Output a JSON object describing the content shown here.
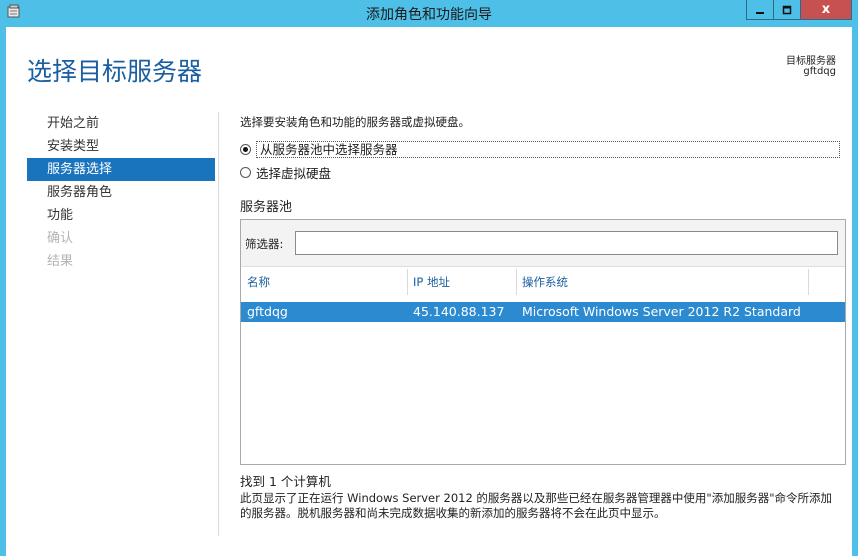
{
  "window": {
    "title": "添加角色和功能向导",
    "controls": {
      "minimize": "_",
      "maximize": "□",
      "close": "x"
    }
  },
  "header": {
    "page_title": "选择目标服务器",
    "target_server_label": "目标服务器",
    "target_server_value": "gftdqg"
  },
  "nav": {
    "items": [
      {
        "label": "开始之前",
        "state": "normal"
      },
      {
        "label": "安装类型",
        "state": "normal"
      },
      {
        "label": "服务器选择",
        "state": "active"
      },
      {
        "label": "服务器角色",
        "state": "normal"
      },
      {
        "label": "功能",
        "state": "normal"
      },
      {
        "label": "确认",
        "state": "disabled"
      },
      {
        "label": "结果",
        "state": "disabled"
      }
    ]
  },
  "main": {
    "description": "选择要安装角色和功能的服务器或虚拟硬盘。",
    "options": [
      {
        "label": "从服务器池中选择服务器",
        "selected": true
      },
      {
        "label": "选择虚拟硬盘",
        "selected": false
      }
    ],
    "pool_label": "服务器池",
    "filter_label": "筛选器:",
    "filter_value": "",
    "columns": [
      "名称",
      "IP 地址",
      "操作系统"
    ],
    "rows": [
      {
        "name": "gftdqg",
        "ip": "45.140.88.137",
        "os": "Microsoft Windows Server 2012 R2 Standard"
      }
    ],
    "found_text": "找到 1 个计算机",
    "note": "此页显示了正在运行 Windows Server 2012 的服务器以及那些已经在服务器管理器中使用\"添加服务器\"命令所添加的服务器。脱机服务器和尚未完成数据收集的新添加的服务器将不会在此页中显示。"
  },
  "colors": {
    "titlebar": "#4ec0e8",
    "accent": "#1a73bd",
    "selected_row": "#2b8ad0",
    "close_button": "#c75050"
  }
}
